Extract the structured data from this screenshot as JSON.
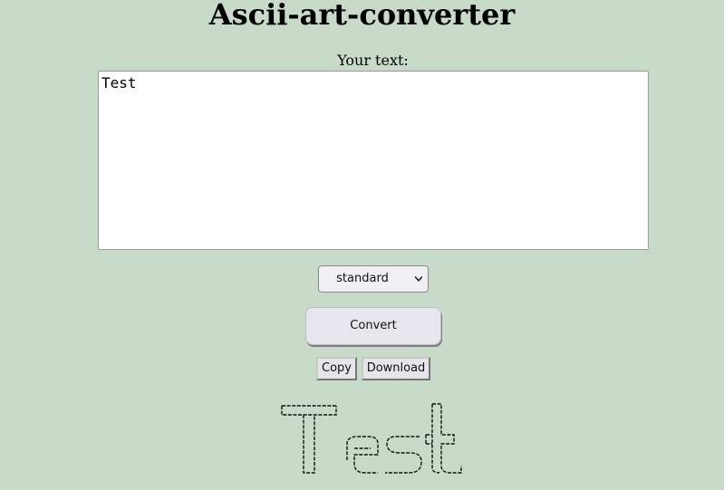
{
  "header": {
    "title": "Ascii-art-converter"
  },
  "form": {
    "text_label": "Your text:",
    "text_value": "Test",
    "font_select": {
      "selected": "standard",
      "chevron_icon": "chevron-down-icon"
    },
    "convert_label": "Convert"
  },
  "actions": {
    "copy_label": "Copy",
    "download_label": "Download"
  },
  "output": {
    "ascii_text": "Test"
  },
  "colors": {
    "background": "#c8dbc9",
    "textarea_bg": "#ffffff",
    "button_bg": "#e7e6ee"
  }
}
